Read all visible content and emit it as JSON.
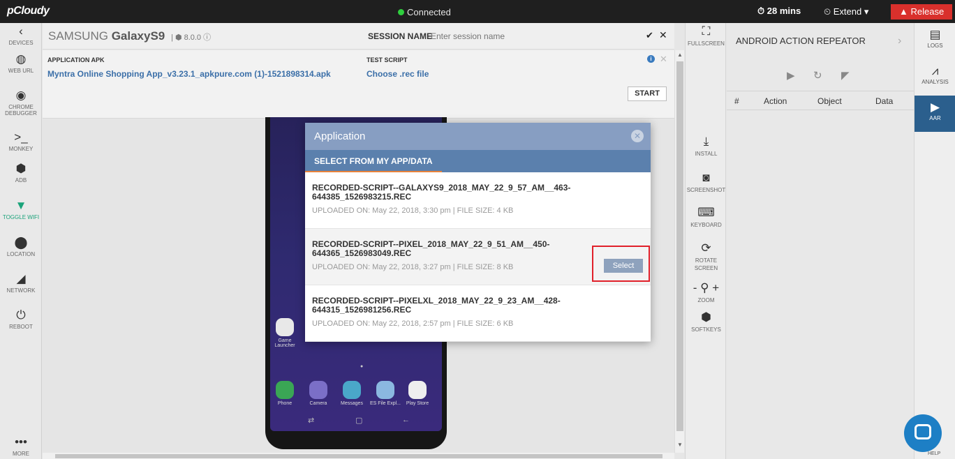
{
  "topbar": {
    "logo": "pCloudy",
    "status": "Connected",
    "timer": "28 mins",
    "extend": "Extend",
    "release": "Release"
  },
  "leftnav": [
    {
      "label": "DEVICES",
      "icon": "chevron-left-icon",
      "glyph": "‹"
    },
    {
      "label": "WEB URL",
      "icon": "globe-icon",
      "glyph": "◍"
    },
    {
      "label": "CHROME DEBUGGER",
      "icon": "chrome-icon",
      "glyph": "◉"
    },
    {
      "label": "MONKEY",
      "icon": "terminal-icon",
      "glyph": ">_"
    },
    {
      "label": "ADB",
      "icon": "android-icon",
      "glyph": "⬢"
    },
    {
      "label": "TOGGLE WIFI",
      "icon": "wifi-icon",
      "glyph": "▼"
    },
    {
      "label": "LOCATION",
      "icon": "location-pin-icon",
      "glyph": "⬤"
    },
    {
      "label": "NETWORK",
      "icon": "network-signal-icon",
      "glyph": "◢"
    },
    {
      "label": "REBOOT",
      "icon": "power-icon",
      "glyph": "⏻"
    },
    {
      "label": "MORE",
      "icon": "more-icon",
      "glyph": "•••"
    }
  ],
  "header": {
    "brand": "SAMSUNG",
    "model": "GalaxyS9",
    "os_version": "8.0.0",
    "session_label": "SESSION NAME",
    "session_placeholder": "Enter session name"
  },
  "apk": {
    "label": "APPLICATION APK",
    "value": "Myntra Online Shopping App_v3.23.1_apkpure.com (1)-1521898314.apk",
    "script_label": "TEST SCRIPT",
    "script_value": "Choose .rec file",
    "start": "START"
  },
  "phone": {
    "apps": [
      {
        "label": "Game Launcher",
        "color": "#e8e8e8"
      },
      {
        "label": "Phone",
        "color": "#3aa655"
      },
      {
        "label": "Camera",
        "color": "#7b6fc7"
      },
      {
        "label": "Messages",
        "color": "#4aa7c9"
      },
      {
        "label": "ES File Expl...",
        "color": "#8bb8e0"
      },
      {
        "label": "Play Store",
        "color": "#eeeeee"
      }
    ]
  },
  "tools": [
    {
      "label": "FULLSCREEN",
      "icon": "fullscreen-icon",
      "glyph": "⛶"
    },
    {
      "label": "INSTALL",
      "icon": "download-icon",
      "glyph": "⤓"
    },
    {
      "label": "SCREENSHOT",
      "icon": "camera-icon",
      "glyph": "◙"
    },
    {
      "label": "KEYBOARD",
      "icon": "keyboard-icon",
      "glyph": "⌨"
    },
    {
      "label": "ROTATE SCREEN",
      "icon": "rotate-icon",
      "glyph": "⟳"
    },
    {
      "label": "ZOOM",
      "icon": "zoom-icon",
      "glyph": "- ⚲ +"
    },
    {
      "label": "SOFTKEYS",
      "icon": "android-icon",
      "glyph": "⬢"
    }
  ],
  "aar": {
    "title": "ANDROID ACTION REPEATOR",
    "columns": [
      "#",
      "Action",
      "Object",
      "Data"
    ]
  },
  "rightnav": [
    {
      "label": "LOGS",
      "icon": "logs-icon",
      "glyph": "▤"
    },
    {
      "label": "ANALYSIS",
      "icon": "analysis-icon",
      "glyph": "⩘"
    },
    {
      "label": "AAR",
      "icon": "play-square-icon",
      "glyph": "▶"
    }
  ],
  "help": "HELP",
  "modal": {
    "title": "Application",
    "tab": "SELECT FROM MY APP/DATA",
    "items": [
      {
        "title": "RECORDED-SCRIPT--GALAXYS9_2018_MAY_22_9_57_AM__463-644385_1526983215.REC",
        "meta": "UPLOADED ON: May 22, 2018, 3:30 pm | FILE SIZE: 4 KB"
      },
      {
        "title": "RECORDED-SCRIPT--PIXEL_2018_MAY_22_9_51_AM__450-644365_1526983049.REC",
        "meta": "UPLOADED ON: May 22, 2018, 3:27 pm | FILE SIZE: 8 KB"
      },
      {
        "title": "RECORDED-SCRIPT--PIXELXL_2018_MAY_22_9_23_AM__428-644315_1526981256.REC",
        "meta": "UPLOADED ON: May 22, 2018, 2:57 pm | FILE SIZE: 6 KB"
      }
    ],
    "select": "Select"
  },
  "colors": {
    "accent": "#5b80ad",
    "release": "#d9302c",
    "connected": "#2fcf3e",
    "highlight": "#e0202a"
  }
}
